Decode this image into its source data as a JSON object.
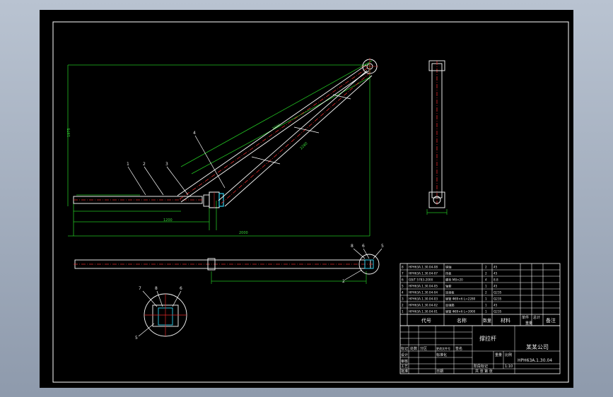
{
  "balloons": {
    "b1": "1",
    "b2": "2",
    "b3": "3",
    "b4": "4",
    "b5": "5",
    "b6": "6",
    "b7": "7",
    "b8": "8"
  },
  "dimensions": {
    "d1": "1975",
    "d2": "3900",
    "d3": "2280",
    "d4": "1200",
    "d5": "2000"
  },
  "parts_list": {
    "headers": {
      "code": "代号",
      "name": "名称",
      "qty": "数量",
      "material": "材料",
      "unit_weight": "单件",
      "total_weight": "总计",
      "weight": "重量",
      "remark": "备注"
    },
    "rows": [
      {
        "no": "8",
        "code": "HPH63A.1.30.04-08",
        "name": "销轴",
        "qty": "2",
        "material": "45",
        "remark": ""
      },
      {
        "no": "7",
        "code": "HPH63A.1.30.04-07",
        "name": "挡板",
        "qty": "2",
        "material": "45",
        "remark": ""
      },
      {
        "no": "6",
        "code": "GB/T 5783-2000",
        "name": "螺栓 M8×20",
        "qty": "4",
        "material": "8.8",
        "remark": ""
      },
      {
        "no": "5",
        "code": "HPH63A.1.30.04-05",
        "name": "轴套",
        "qty": "1",
        "material": "45",
        "remark": ""
      },
      {
        "no": "4",
        "code": "HPH63A.1.30.04-04",
        "name": "连接板",
        "qty": "2",
        "material": "Q235",
        "remark": ""
      },
      {
        "no": "3",
        "code": "HPH63A.1.30.04-03",
        "name": "钢管 Φ89×6 L=2280",
        "qty": "1",
        "material": "Q235",
        "remark": ""
      },
      {
        "no": "2",
        "code": "HPH63A.1.30.04-02",
        "name": "加强筋",
        "qty": "1",
        "material": "45",
        "remark": ""
      },
      {
        "no": "1",
        "code": "HPH63A.1.30.04-01",
        "name": "钢管 Φ89×6 L=3900",
        "qty": "1",
        "material": "Q235",
        "remark": ""
      }
    ]
  },
  "title_block": {
    "part_name": "撑拉杆",
    "company": "某某公司",
    "drawing_number": "HPH63A.1.30.04",
    "scale": "1:10",
    "sheet": "共 张 第 张",
    "design": "设计",
    "check": "审核",
    "process": "工艺",
    "approve": "批准",
    "date": "日期",
    "standardize": "标准化",
    "stage_mark": "阶段标记",
    "weight": "重量",
    "ratio": "比例",
    "mark": "标记",
    "count": "处数",
    "zone": "分区",
    "change_doc": "更改文件号",
    "signature": "签名",
    "ymd": "年、月、日"
  },
  "colors": {
    "frame": "#ffffff",
    "dimension": "#22c022",
    "centerline": "#e02828",
    "part": "#ffffff",
    "highlight": "#30d0f0",
    "background": "#000000"
  }
}
